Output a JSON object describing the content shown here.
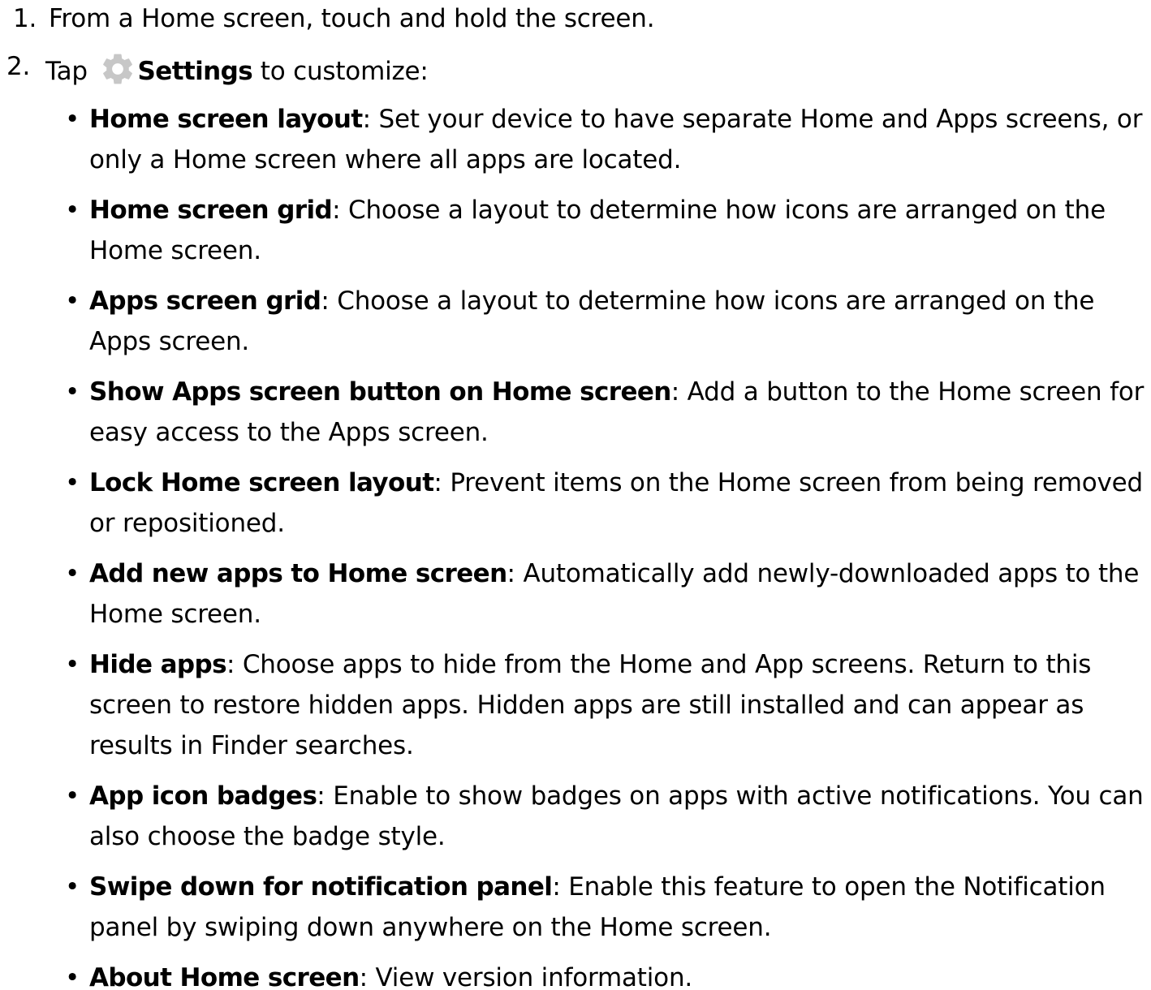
{
  "steps": [
    {
      "number": "1.",
      "text": "From a Home screen, touch and hold the screen."
    },
    {
      "number": "2.",
      "pre": "Tap",
      "settings_label": "Settings",
      "post": "to customize:",
      "icon": "gear-icon"
    }
  ],
  "colors": {
    "gear_icon": "#c7c7c7",
    "text": "#000000"
  },
  "options": [
    {
      "term": "Home screen layout",
      "desc": ": Set your device to have separate Home and Apps screens, or only a Home screen where all apps are located."
    },
    {
      "term": "Home screen grid",
      "desc": ": Choose a layout to determine how icons are arranged on the Home screen."
    },
    {
      "term": "Apps screen grid",
      "desc": ": Choose a layout to determine how icons are arranged on the Apps screen."
    },
    {
      "term": "Show Apps screen button on Home screen",
      "desc": ": Add a button to the Home screen for easy access to the Apps screen."
    },
    {
      "term": "Lock Home screen layout",
      "desc": ": Prevent items on the Home screen from being removed or repositioned."
    },
    {
      "term": "Add new apps to Home screen",
      "desc": ": Automatically add newly-downloaded apps to the Home screen."
    },
    {
      "term": "Hide apps",
      "desc": ": Choose apps to hide from the Home and App screens. Return to this screen to restore hidden apps. Hidden apps are still installed and can appear as results in Finder searches."
    },
    {
      "term": "App icon badges",
      "desc": ": Enable to show badges on apps with active notifications. You can also choose the badge style."
    },
    {
      "term": "Swipe down for notification panel",
      "desc": ": Enable this feature to open the Notification panel by swiping down anywhere on the Home screen."
    },
    {
      "term": "About Home screen",
      "desc": ": View version information."
    }
  ]
}
